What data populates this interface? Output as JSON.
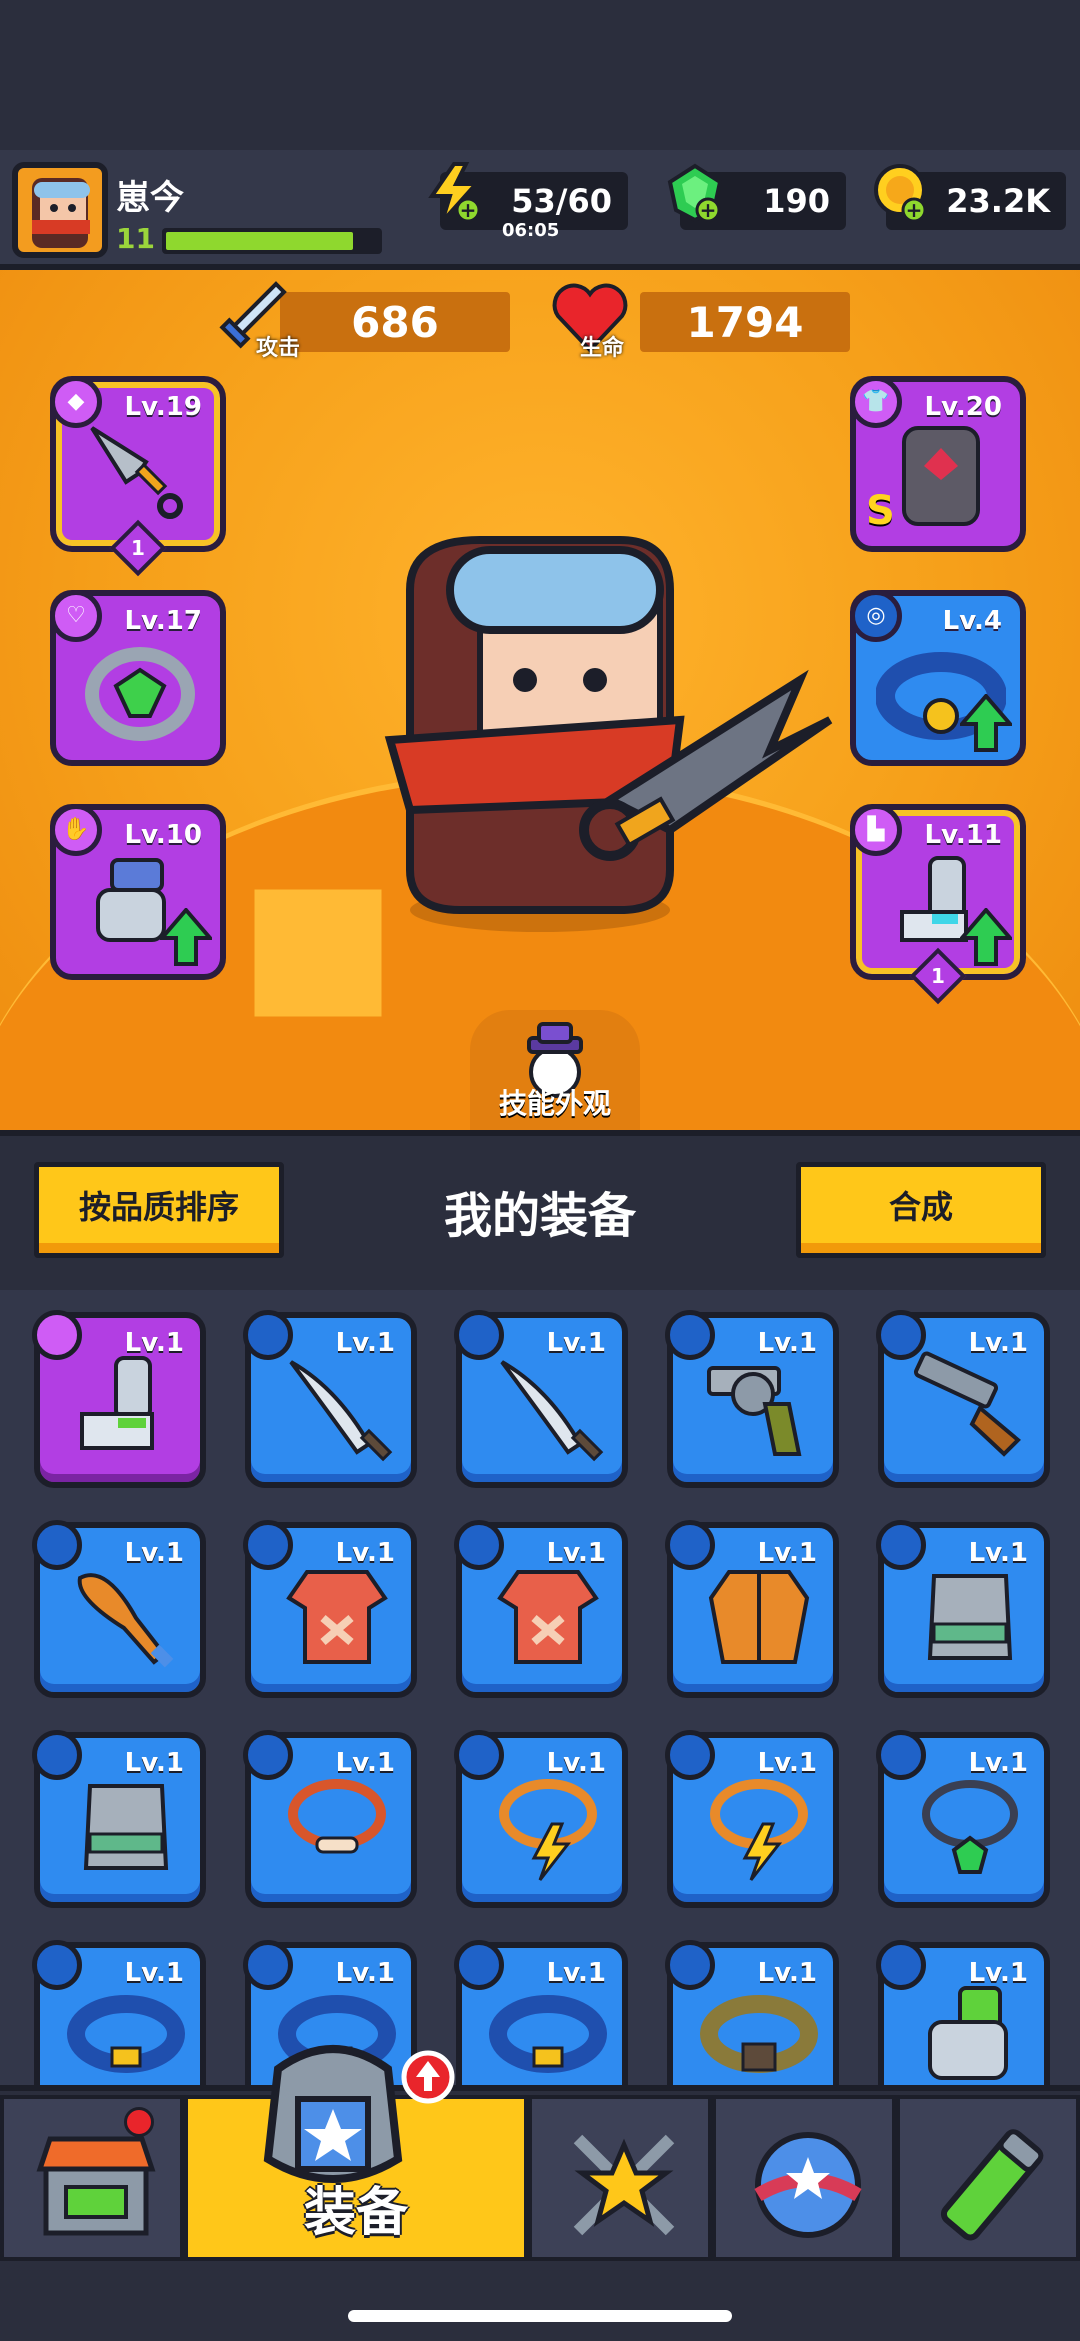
{
  "player": {
    "name": "崽今",
    "level": "11",
    "xp_fraction": 0.88
  },
  "resources": {
    "energy": {
      "value": "53/60",
      "timer": "06:05"
    },
    "gems": {
      "value": "190"
    },
    "coins": {
      "value": "23.2K"
    }
  },
  "stats": {
    "attack": {
      "label": "攻击",
      "value": "686"
    },
    "hp": {
      "label": "生命",
      "value": "1794"
    }
  },
  "equipped": {
    "weapon": {
      "level": "Lv.19",
      "stars": "1"
    },
    "armor": {
      "level": "Lv.20",
      "grade": "S"
    },
    "necklace": {
      "level": "Lv.17"
    },
    "belt": {
      "level": "Lv.4"
    },
    "gloves": {
      "level": "Lv.10"
    },
    "boots": {
      "level": "Lv.11",
      "stars": "1"
    }
  },
  "skin_tab": {
    "label": "技能外观"
  },
  "section": {
    "title": "我的装备",
    "sort_label": "按品质排序",
    "merge_label": "合成"
  },
  "inventory": [
    {
      "lv": "Lv.1",
      "item": "boots-icon",
      "rarity": "purple"
    },
    {
      "lv": "Lv.1",
      "item": "sword-icon",
      "rarity": "blue"
    },
    {
      "lv": "Lv.1",
      "item": "sword-icon",
      "rarity": "blue"
    },
    {
      "lv": "Lv.1",
      "item": "revolver-icon",
      "rarity": "blue"
    },
    {
      "lv": "Lv.1",
      "item": "shotgun-icon",
      "rarity": "blue"
    },
    {
      "lv": "Lv.1",
      "item": "bat-icon",
      "rarity": "blue"
    },
    {
      "lv": "Lv.1",
      "item": "shirt-icon",
      "rarity": "blue"
    },
    {
      "lv": "Lv.1",
      "item": "shirt-icon",
      "rarity": "blue"
    },
    {
      "lv": "Lv.1",
      "item": "jacket-icon",
      "rarity": "blue"
    },
    {
      "lv": "Lv.1",
      "item": "vest-icon",
      "rarity": "blue"
    },
    {
      "lv": "Lv.1",
      "item": "vest-icon",
      "rarity": "blue"
    },
    {
      "lv": "Lv.1",
      "item": "bone-necklace-icon",
      "rarity": "blue"
    },
    {
      "lv": "Lv.1",
      "item": "lightning-necklace-icon",
      "rarity": "blue"
    },
    {
      "lv": "Lv.1",
      "item": "lightning-necklace-icon",
      "rarity": "blue"
    },
    {
      "lv": "Lv.1",
      "item": "gem-necklace-icon",
      "rarity": "blue"
    },
    {
      "lv": "Lv.1",
      "item": "belt-icon",
      "rarity": "blue"
    },
    {
      "lv": "Lv.1",
      "item": "belt-icon",
      "rarity": "blue"
    },
    {
      "lv": "Lv.1",
      "item": "belt-icon",
      "rarity": "blue"
    },
    {
      "lv": "Lv.1",
      "item": "leather-belt-icon",
      "rarity": "blue"
    },
    {
      "lv": "Lv.1",
      "item": "glove-icon",
      "rarity": "blue"
    }
  ],
  "nav": {
    "tabs": [
      {
        "name": "shop-tab",
        "icon": "shop-icon"
      },
      {
        "name": "equipment-tab",
        "icon": "equipment-icon",
        "label": "装备",
        "active": true
      },
      {
        "name": "battle-tab",
        "icon": "crossed-swords-star-icon"
      },
      {
        "name": "talent-tab",
        "icon": "star-ball-icon"
      },
      {
        "name": "gene-tab",
        "icon": "dna-capsule-icon"
      }
    ]
  },
  "colors": {
    "blue_rarity": "#2f8bf0",
    "purple_rarity": "#b23ee3",
    "accent": "#ffc719"
  }
}
